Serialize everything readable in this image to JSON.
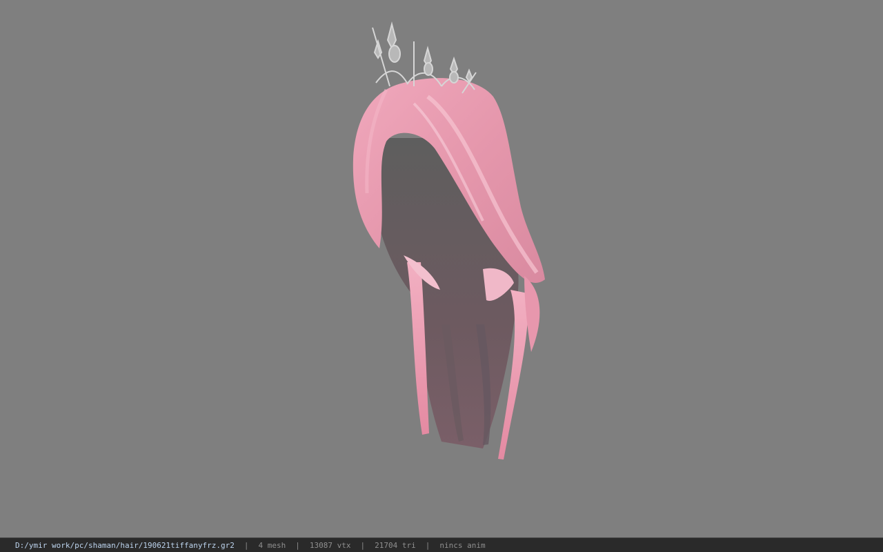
{
  "viewport": {
    "background_color": "#7f7f7f",
    "model": {
      "hair_color": "#e8a0b4",
      "hair_shadow_color": "#6f5a5f",
      "crown_color": "#c8c8c8"
    }
  },
  "status_bar": {
    "file_path": "D:/ymir work/pc/shaman/hair/190621tiffanyfrz.gr2",
    "separator": "|",
    "mesh_count": "4 mesh",
    "vertex_count": "13087 vtx",
    "triangle_count": "21704 tri",
    "anim_status": "nincs anim"
  }
}
